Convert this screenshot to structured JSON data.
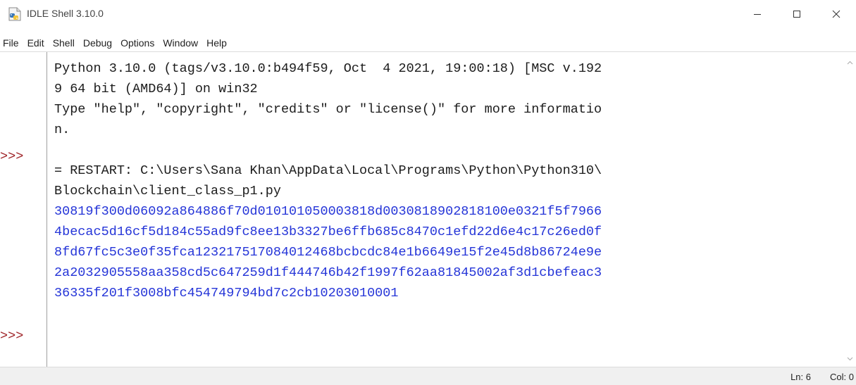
{
  "window": {
    "title": "IDLE Shell 3.10.0",
    "app_icon": "python-idle-icon"
  },
  "menubar": {
    "items": [
      "File",
      "Edit",
      "Shell",
      "Debug",
      "Options",
      "Window",
      "Help"
    ]
  },
  "shell": {
    "prompts": [
      ">>>",
      ">>>"
    ],
    "lines": [
      {
        "text": "Python 3.10.0 (tags/v3.10.0:b494f59, Oct  4 2021, 19:00:18) [MSC v.192",
        "kind": "banner"
      },
      {
        "text": "9 64 bit (AMD64)] on win32",
        "kind": "banner"
      },
      {
        "text": "Type \"help\", \"copyright\", \"credits\" or \"license()\" for more informatio",
        "kind": "banner"
      },
      {
        "text": "n.",
        "kind": "banner"
      },
      {
        "text": "",
        "kind": "input"
      },
      {
        "text": "= RESTART: C:\\Users\\Sana Khan\\AppData\\Local\\Programs\\Python\\Python310\\",
        "kind": "restart"
      },
      {
        "text": "Blockchain\\client_class_p1.py",
        "kind": "restart"
      },
      {
        "text": "30819f300d06092a864886f70d010101050003818d0030818902818100e0321f5f7966",
        "kind": "stdout"
      },
      {
        "text": "4becac5d16cf5d184c55ad9fc8ee13b3327be6ffb685c8470c1efd22d6e4c17c26ed0f",
        "kind": "stdout"
      },
      {
        "text": "8fd67fc5c3e0f35fca123217517084012468bcbcdc84e1b6649e15f2e45d8b86724e9e",
        "kind": "stdout"
      },
      {
        "text": "2a2032905558aa358cd5c647259d1f444746b42f1997f62aa81845002af3d1cbefeac3",
        "kind": "stdout"
      },
      {
        "text": "36335f201f3008bfc454749794bd7c2cb10203010001",
        "kind": "stdout"
      },
      {
        "text": "",
        "kind": "input"
      }
    ]
  },
  "statusbar": {
    "line": "Ln: 6",
    "col": "Col: 0"
  },
  "colors": {
    "prompt": "#a0262a",
    "stdout": "#2535d8",
    "text": "#1c1c1c"
  }
}
